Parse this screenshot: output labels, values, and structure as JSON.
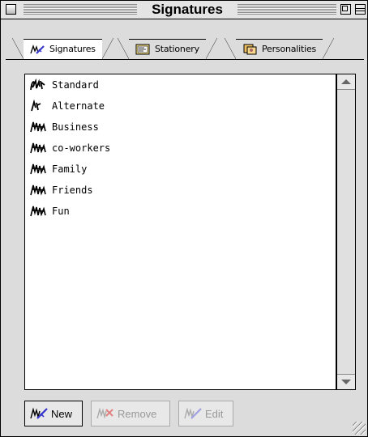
{
  "window": {
    "title": "Signatures"
  },
  "tabs": [
    {
      "label": "Signatures",
      "icon": "signature-pen-icon",
      "active": true
    },
    {
      "label": "Stationery",
      "icon": "stationery-icon",
      "active": false
    },
    {
      "label": "Personalities",
      "icon": "personalities-icon",
      "active": false
    }
  ],
  "signatures": [
    {
      "label": "Standard",
      "icon": "signature-icon"
    },
    {
      "label": "Alternate",
      "icon": "signature-icon"
    },
    {
      "label": "Business",
      "icon": "signature-icon"
    },
    {
      "label": "co-workers",
      "icon": "signature-icon"
    },
    {
      "label": "Family",
      "icon": "signature-icon"
    },
    {
      "label": "Friends",
      "icon": "signature-icon"
    },
    {
      "label": "Fun",
      "icon": "signature-icon"
    }
  ],
  "buttons": {
    "new_label": "New",
    "remove_label": "Remove",
    "edit_label": "Edit"
  },
  "colors": {
    "window_bg": "#dcdcdc",
    "list_bg": "#ffffff",
    "accent": "#3333cc"
  }
}
